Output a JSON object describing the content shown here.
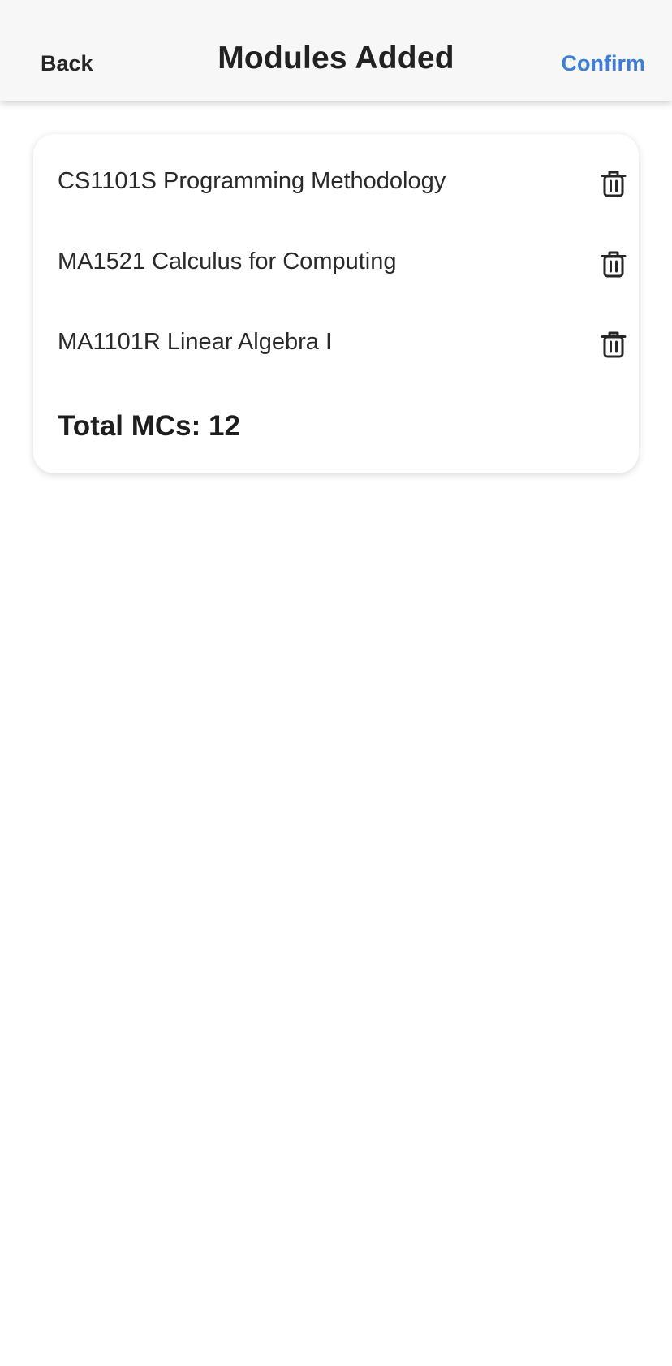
{
  "header": {
    "back_label": "Back",
    "title": "Modules Added",
    "confirm_label": "Confirm"
  },
  "modules": [
    {
      "name": "CS1101S Programming Methodology",
      "delete_icon": "trash-icon"
    },
    {
      "name": "MA1521 Calculus for Computing",
      "delete_icon": "trash-icon"
    },
    {
      "name": "MA1101R Linear Algebra I",
      "delete_icon": "trash-icon"
    }
  ],
  "total_label": "Total MCs: 12",
  "colors": {
    "accent": "#3a7fdb",
    "header_bg": "#f7f7f7",
    "text": "#262626"
  }
}
